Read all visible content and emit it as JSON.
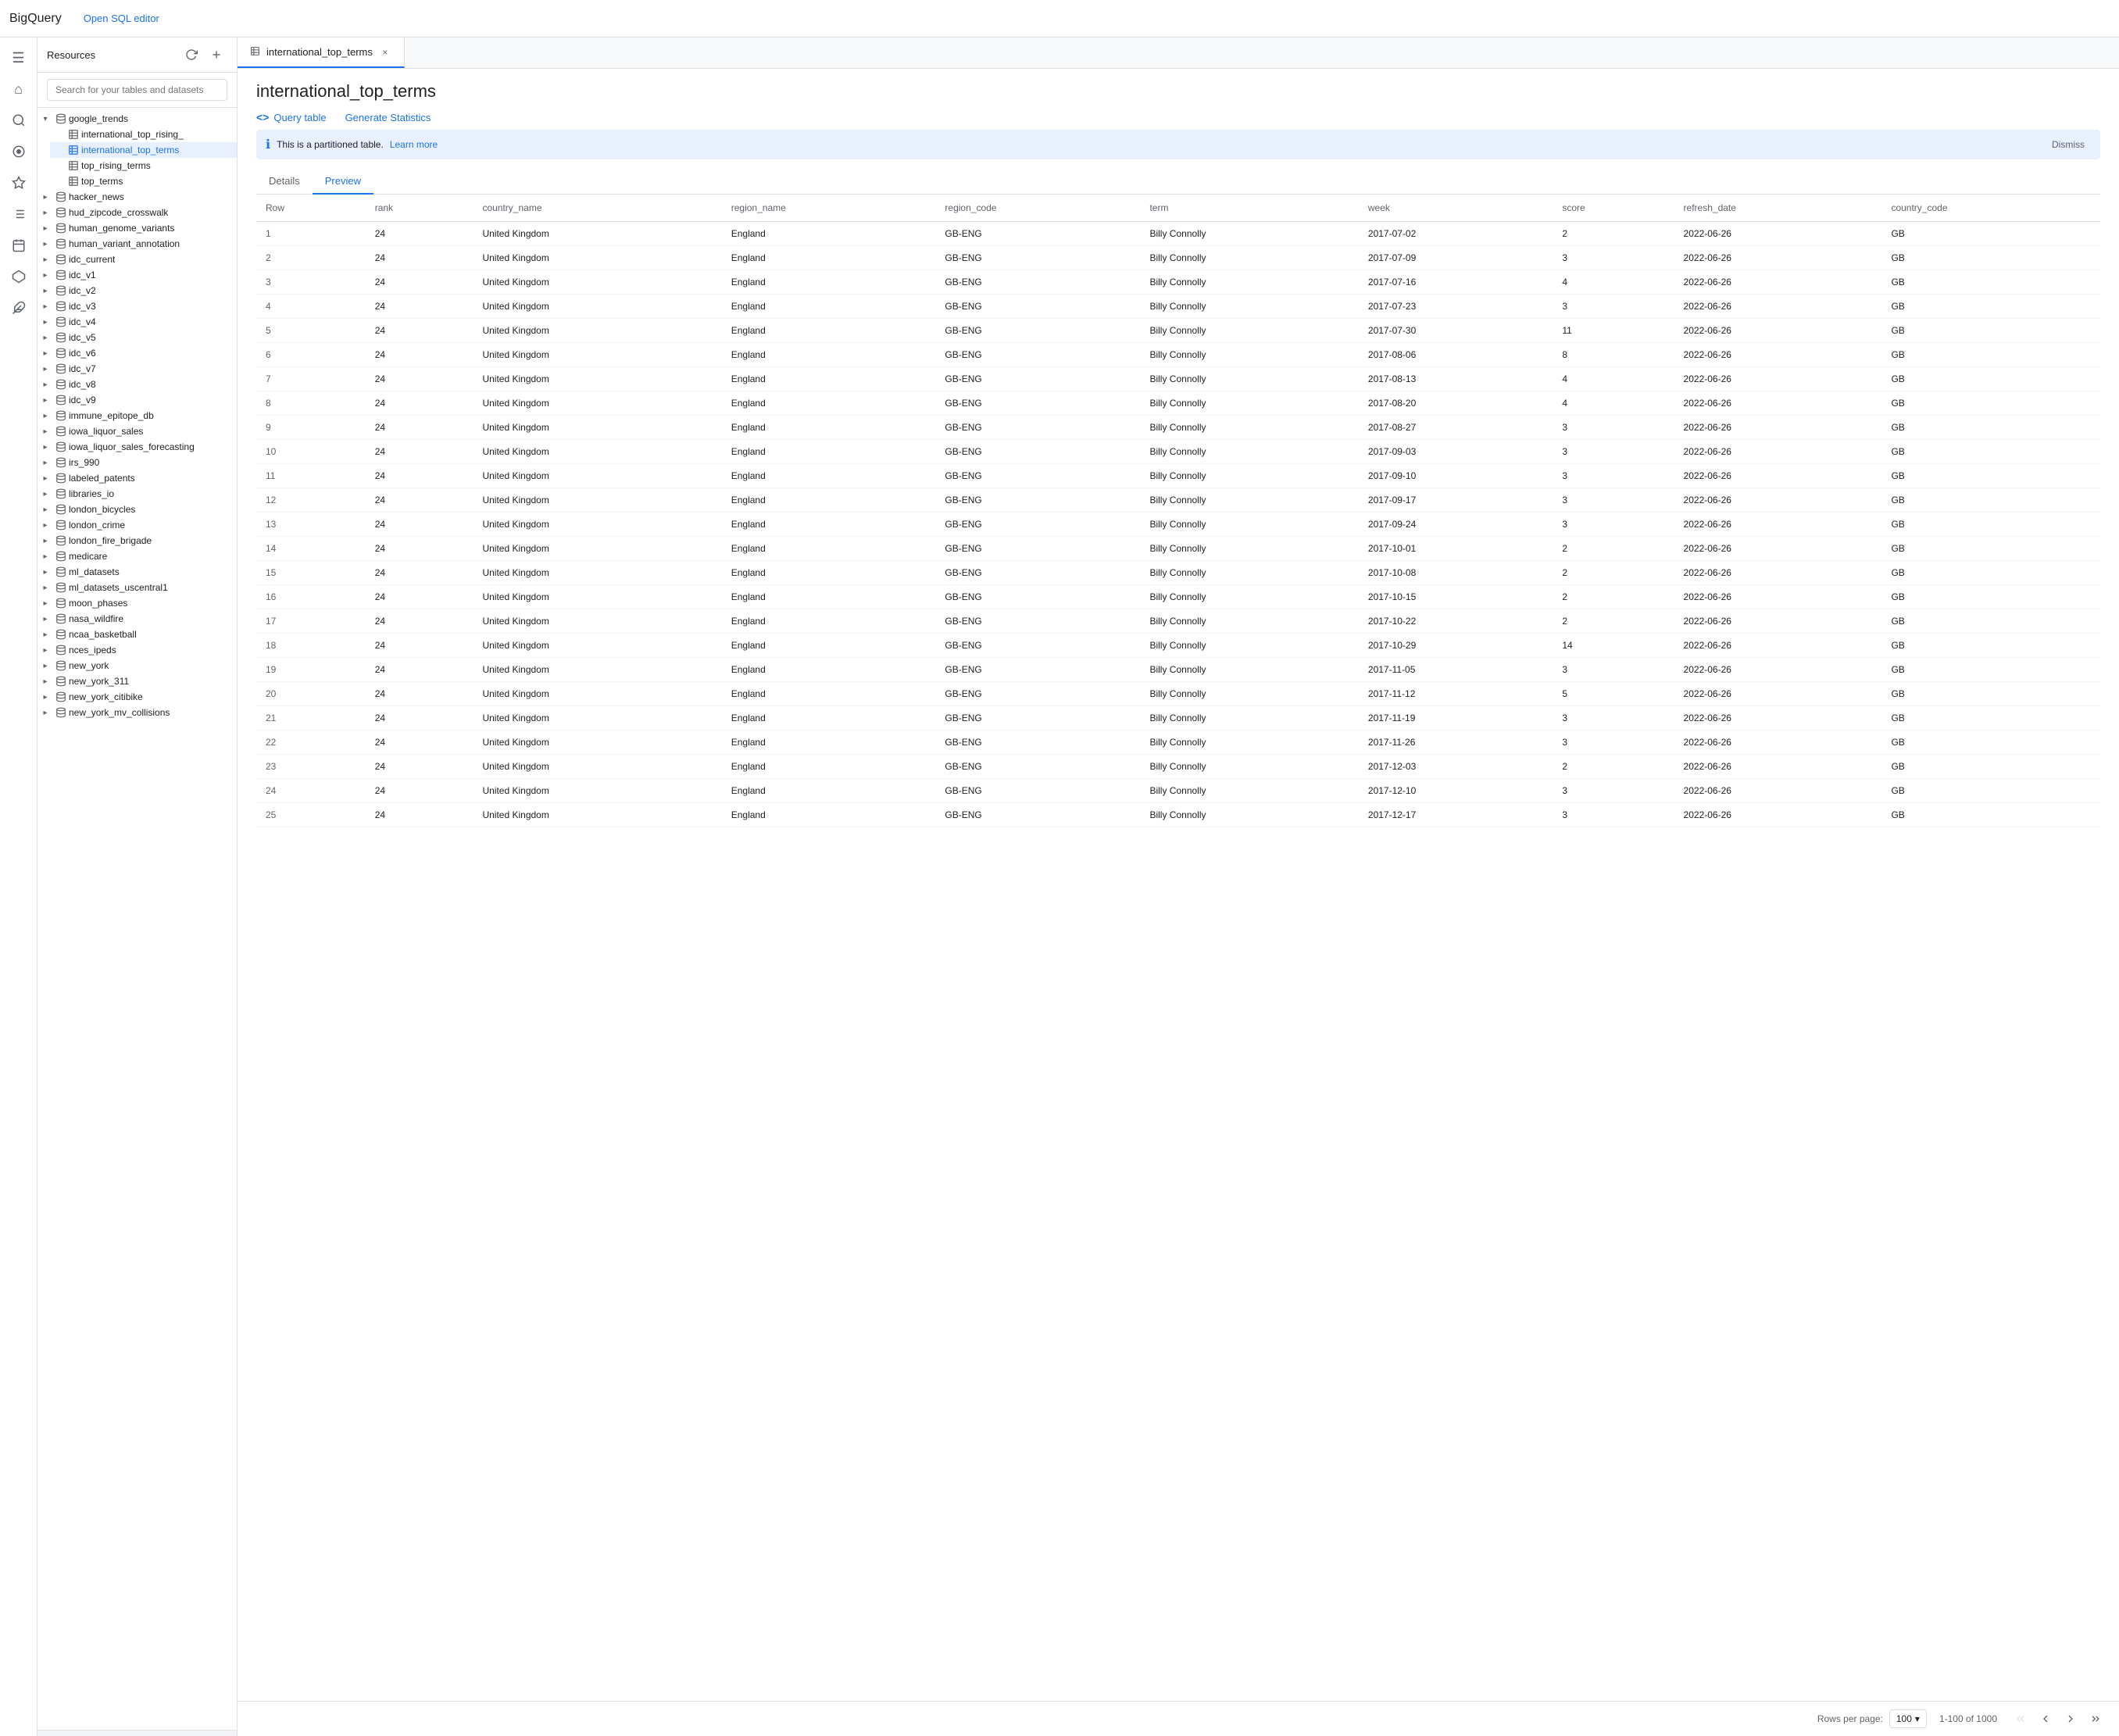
{
  "app": {
    "title": "BigQuery",
    "open_sql_label": "Open SQL editor"
  },
  "left_nav": {
    "icons": [
      {
        "name": "menu-icon",
        "symbol": "☰",
        "active": false
      },
      {
        "name": "home-icon",
        "symbol": "⌂",
        "active": false
      },
      {
        "name": "search-icon",
        "symbol": "🔍",
        "active": false
      },
      {
        "name": "circle-icon",
        "symbol": "◉",
        "active": false
      },
      {
        "name": "tag-icon",
        "symbol": "◈",
        "active": false
      },
      {
        "name": "list-icon",
        "symbol": "≡",
        "active": false
      },
      {
        "name": "calendar-icon",
        "symbol": "▦",
        "active": false
      },
      {
        "name": "graph-icon",
        "symbol": "⬡",
        "active": false
      },
      {
        "name": "plugin-icon",
        "symbol": "✦",
        "active": false
      }
    ]
  },
  "sidebar": {
    "title": "Resources",
    "search_placeholder": "Search for your tables and datasets",
    "tree": [
      {
        "id": "google_trends",
        "label": "google_trends",
        "type": "dataset",
        "expanded": true,
        "children": [
          {
            "id": "international_top_rising_",
            "label": "international_top_rising_",
            "type": "table"
          },
          {
            "id": "international_top_terms",
            "label": "international_top_terms",
            "type": "table",
            "selected": true
          },
          {
            "id": "top_rising_terms",
            "label": "top_rising_terms",
            "type": "table"
          },
          {
            "id": "top_terms",
            "label": "top_terms",
            "type": "table"
          }
        ]
      },
      {
        "id": "hacker_news",
        "label": "hacker_news",
        "type": "dataset",
        "expanded": false
      },
      {
        "id": "hud_zipcode_crosswalk",
        "label": "hud_zipcode_crosswalk",
        "type": "dataset",
        "expanded": false
      },
      {
        "id": "human_genome_variants",
        "label": "human_genome_variants",
        "type": "dataset",
        "expanded": false
      },
      {
        "id": "human_variant_annotation",
        "label": "human_variant_annotation",
        "type": "dataset",
        "expanded": false
      },
      {
        "id": "idc_current",
        "label": "idc_current",
        "type": "dataset",
        "expanded": false
      },
      {
        "id": "idc_v1",
        "label": "idc_v1",
        "type": "dataset",
        "expanded": false
      },
      {
        "id": "idc_v2",
        "label": "idc_v2",
        "type": "dataset",
        "expanded": false
      },
      {
        "id": "idc_v3",
        "label": "idc_v3",
        "type": "dataset",
        "expanded": false
      },
      {
        "id": "idc_v4",
        "label": "idc_v4",
        "type": "dataset",
        "expanded": false
      },
      {
        "id": "idc_v5",
        "label": "idc_v5",
        "type": "dataset",
        "expanded": false
      },
      {
        "id": "idc_v6",
        "label": "idc_v6",
        "type": "dataset",
        "expanded": false
      },
      {
        "id": "idc_v7",
        "label": "idc_v7",
        "type": "dataset",
        "expanded": false
      },
      {
        "id": "idc_v8",
        "label": "idc_v8",
        "type": "dataset",
        "expanded": false
      },
      {
        "id": "idc_v9",
        "label": "idc_v9",
        "type": "dataset",
        "expanded": false
      },
      {
        "id": "immune_epitope_db",
        "label": "immune_epitope_db",
        "type": "dataset",
        "expanded": false
      },
      {
        "id": "iowa_liquor_sales",
        "label": "iowa_liquor_sales",
        "type": "dataset",
        "expanded": false
      },
      {
        "id": "iowa_liquor_sales_forecasting",
        "label": "iowa_liquor_sales_forecasting",
        "type": "dataset",
        "expanded": false
      },
      {
        "id": "irs_990",
        "label": "irs_990",
        "type": "dataset",
        "expanded": false
      },
      {
        "id": "labeled_patents",
        "label": "labeled_patents",
        "type": "dataset",
        "expanded": false
      },
      {
        "id": "libraries_io",
        "label": "libraries_io",
        "type": "dataset",
        "expanded": false
      },
      {
        "id": "london_bicycles",
        "label": "london_bicycles",
        "type": "dataset",
        "expanded": false
      },
      {
        "id": "london_crime",
        "label": "london_crime",
        "type": "dataset",
        "expanded": false
      },
      {
        "id": "london_fire_brigade",
        "label": "london_fire_brigade",
        "type": "dataset",
        "expanded": false
      },
      {
        "id": "medicare",
        "label": "medicare",
        "type": "dataset",
        "expanded": false
      },
      {
        "id": "ml_datasets",
        "label": "ml_datasets",
        "type": "dataset",
        "expanded": false
      },
      {
        "id": "ml_datasets_uscentral1",
        "label": "ml_datasets_uscentral1",
        "type": "dataset",
        "expanded": false
      },
      {
        "id": "moon_phases",
        "label": "moon_phases",
        "type": "dataset",
        "expanded": false
      },
      {
        "id": "nasa_wildfire",
        "label": "nasa_wildfire",
        "type": "dataset",
        "expanded": false
      },
      {
        "id": "ncaa_basketball",
        "label": "ncaa_basketball",
        "type": "dataset",
        "expanded": false
      },
      {
        "id": "nces_ipeds",
        "label": "nces_ipeds",
        "type": "dataset",
        "expanded": false
      },
      {
        "id": "new_york",
        "label": "new_york",
        "type": "dataset",
        "expanded": false
      },
      {
        "id": "new_york_311",
        "label": "new_york_311",
        "type": "dataset",
        "expanded": false
      },
      {
        "id": "new_york_citibike",
        "label": "new_york_citibike",
        "type": "dataset",
        "expanded": false
      },
      {
        "id": "new_york_mv_collisions",
        "label": "new_york_mv_collisions",
        "type": "dataset",
        "expanded": false
      }
    ]
  },
  "tab": {
    "label": "international_top_terms",
    "close_label": "×"
  },
  "page": {
    "title": "international_top_terms",
    "query_table_label": "Query table",
    "generate_statistics_label": "Generate Statistics",
    "info_text": "This is a partitioned table.",
    "learn_more_label": "Learn more",
    "dismiss_label": "Dismiss",
    "tabs": [
      "Details",
      "Preview"
    ],
    "active_tab": "Preview"
  },
  "table": {
    "columns": [
      "Row",
      "rank",
      "country_name",
      "region_name",
      "region_code",
      "term",
      "week",
      "score",
      "refresh_date",
      "country_code"
    ],
    "rows": [
      [
        1,
        24,
        "United Kingdom",
        "England",
        "GB-ENG",
        "Billy Connolly",
        "2017-07-02",
        2,
        "2022-06-26",
        "GB"
      ],
      [
        2,
        24,
        "United Kingdom",
        "England",
        "GB-ENG",
        "Billy Connolly",
        "2017-07-09",
        3,
        "2022-06-26",
        "GB"
      ],
      [
        3,
        24,
        "United Kingdom",
        "England",
        "GB-ENG",
        "Billy Connolly",
        "2017-07-16",
        4,
        "2022-06-26",
        "GB"
      ],
      [
        4,
        24,
        "United Kingdom",
        "England",
        "GB-ENG",
        "Billy Connolly",
        "2017-07-23",
        3,
        "2022-06-26",
        "GB"
      ],
      [
        5,
        24,
        "United Kingdom",
        "England",
        "GB-ENG",
        "Billy Connolly",
        "2017-07-30",
        11,
        "2022-06-26",
        "GB"
      ],
      [
        6,
        24,
        "United Kingdom",
        "England",
        "GB-ENG",
        "Billy Connolly",
        "2017-08-06",
        8,
        "2022-06-26",
        "GB"
      ],
      [
        7,
        24,
        "United Kingdom",
        "England",
        "GB-ENG",
        "Billy Connolly",
        "2017-08-13",
        4,
        "2022-06-26",
        "GB"
      ],
      [
        8,
        24,
        "United Kingdom",
        "England",
        "GB-ENG",
        "Billy Connolly",
        "2017-08-20",
        4,
        "2022-06-26",
        "GB"
      ],
      [
        9,
        24,
        "United Kingdom",
        "England",
        "GB-ENG",
        "Billy Connolly",
        "2017-08-27",
        3,
        "2022-06-26",
        "GB"
      ],
      [
        10,
        24,
        "United Kingdom",
        "England",
        "GB-ENG",
        "Billy Connolly",
        "2017-09-03",
        3,
        "2022-06-26",
        "GB"
      ],
      [
        11,
        24,
        "United Kingdom",
        "England",
        "GB-ENG",
        "Billy Connolly",
        "2017-09-10",
        3,
        "2022-06-26",
        "GB"
      ],
      [
        12,
        24,
        "United Kingdom",
        "England",
        "GB-ENG",
        "Billy Connolly",
        "2017-09-17",
        3,
        "2022-06-26",
        "GB"
      ],
      [
        13,
        24,
        "United Kingdom",
        "England",
        "GB-ENG",
        "Billy Connolly",
        "2017-09-24",
        3,
        "2022-06-26",
        "GB"
      ],
      [
        14,
        24,
        "United Kingdom",
        "England",
        "GB-ENG",
        "Billy Connolly",
        "2017-10-01",
        2,
        "2022-06-26",
        "GB"
      ],
      [
        15,
        24,
        "United Kingdom",
        "England",
        "GB-ENG",
        "Billy Connolly",
        "2017-10-08",
        2,
        "2022-06-26",
        "GB"
      ],
      [
        16,
        24,
        "United Kingdom",
        "England",
        "GB-ENG",
        "Billy Connolly",
        "2017-10-15",
        2,
        "2022-06-26",
        "GB"
      ],
      [
        17,
        24,
        "United Kingdom",
        "England",
        "GB-ENG",
        "Billy Connolly",
        "2017-10-22",
        2,
        "2022-06-26",
        "GB"
      ],
      [
        18,
        24,
        "United Kingdom",
        "England",
        "GB-ENG",
        "Billy Connolly",
        "2017-10-29",
        14,
        "2022-06-26",
        "GB"
      ],
      [
        19,
        24,
        "United Kingdom",
        "England",
        "GB-ENG",
        "Billy Connolly",
        "2017-11-05",
        3,
        "2022-06-26",
        "GB"
      ],
      [
        20,
        24,
        "United Kingdom",
        "England",
        "GB-ENG",
        "Billy Connolly",
        "2017-11-12",
        5,
        "2022-06-26",
        "GB"
      ],
      [
        21,
        24,
        "United Kingdom",
        "England",
        "GB-ENG",
        "Billy Connolly",
        "2017-11-19",
        3,
        "2022-06-26",
        "GB"
      ],
      [
        22,
        24,
        "United Kingdom",
        "England",
        "GB-ENG",
        "Billy Connolly",
        "2017-11-26",
        3,
        "2022-06-26",
        "GB"
      ],
      [
        23,
        24,
        "United Kingdom",
        "England",
        "GB-ENG",
        "Billy Connolly",
        "2017-12-03",
        2,
        "2022-06-26",
        "GB"
      ],
      [
        24,
        24,
        "United Kingdom",
        "England",
        "GB-ENG",
        "Billy Connolly",
        "2017-12-10",
        3,
        "2022-06-26",
        "GB"
      ],
      [
        25,
        24,
        "United Kingdom",
        "England",
        "GB-ENG",
        "Billy Connolly",
        "2017-12-17",
        3,
        "2022-06-26",
        "GB"
      ]
    ]
  },
  "footer": {
    "rows_per_page_label": "Rows per page:",
    "rows_per_page_value": "100",
    "pagination_info": "1-100 of 1000",
    "first_page_icon": "⏮",
    "prev_page_icon": "‹",
    "next_page_icon": "›",
    "last_page_icon": "⏭"
  }
}
